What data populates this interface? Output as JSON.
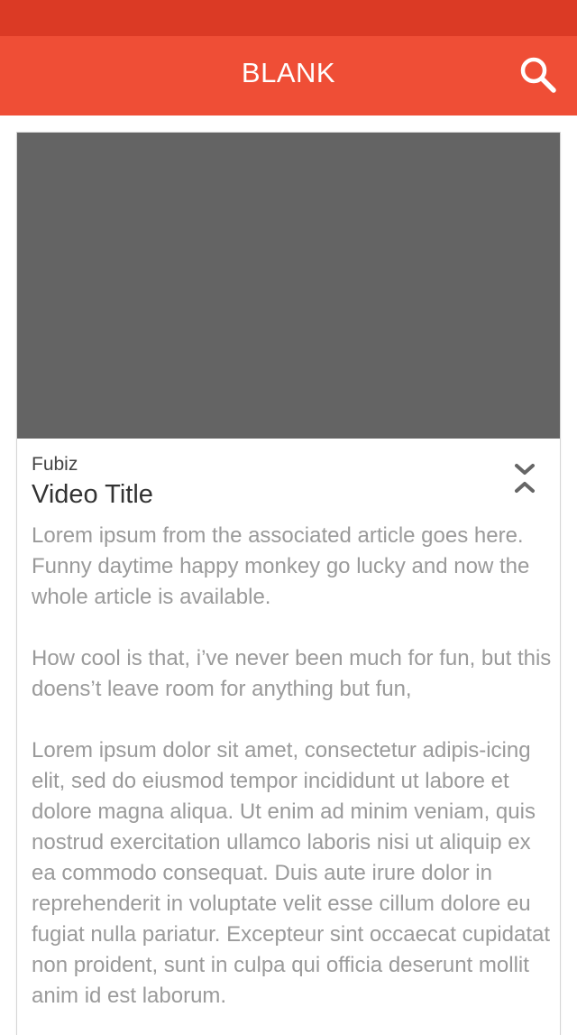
{
  "app_bar": {
    "title": "BLANK",
    "search_icon": "search-icon"
  },
  "card": {
    "source": "Fubiz",
    "title": "Video Title",
    "collapse_icon": "chevron-up-down-icon",
    "paragraphs": [
      "Lorem ipsum from the associated article goes here. Funny daytime happy monkey go lucky and now the whole article is available.",
      "How cool is that, i’ve never been much for fun, but this doens’t leave room for anything but fun,",
      "Lorem ipsum dolor sit amet, consectetur adipis-icing elit, sed do eiusmod tempor incididunt ut labore et dolore magna aliqua. Ut enim ad minim veniam, quis nostrud exercitation ullamco laboris nisi ut aliquip ex ea commodo consequat. Duis aute irure dolor in reprehenderit in voluptate velit esse cillum dolore eu fugiat nulla pariatur. Excepteur sint occaecat cupidatat non proident, sunt in culpa qui officia deserunt mollit anim id est laborum."
    ]
  },
  "colors": {
    "status_bar": "#db3a25",
    "app_bar": "#ef4e36",
    "video_placeholder": "#646464",
    "body_text": "#9a9a9a"
  }
}
